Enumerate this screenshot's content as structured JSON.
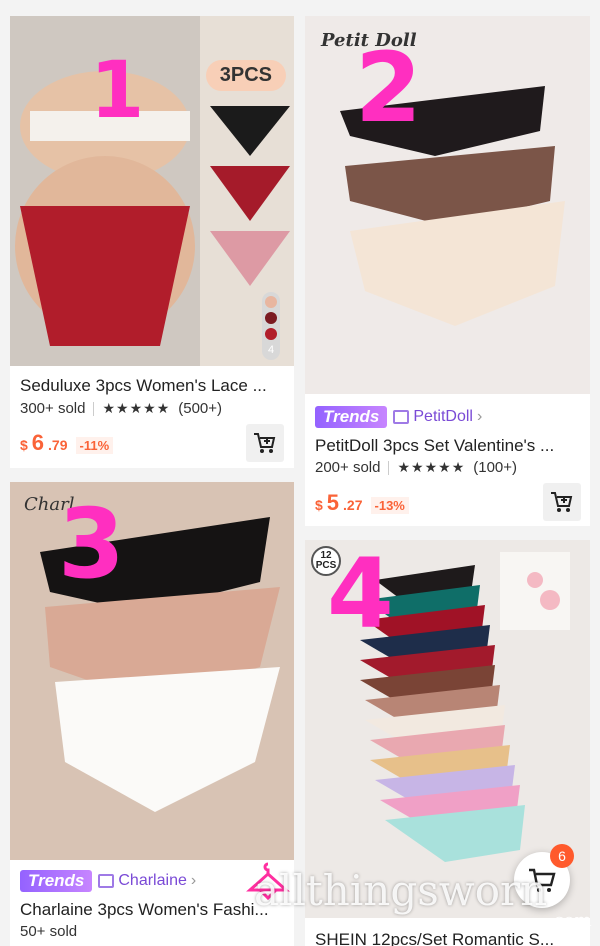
{
  "products": [
    {
      "title": "Seduluxe 3pcs Women's Lace ...",
      "sold": "300+ sold",
      "stars": "★★★★★",
      "reviews": "(500+)",
      "price_currency": "$",
      "price_int": "6",
      "price_dec": ".79",
      "discount": "-11%",
      "pack_badge": "3PCS",
      "image_count": "4",
      "annotation": "1"
    },
    {
      "brand_watermark": "Petit Doll",
      "trend_badge": "Trends",
      "store": "PetitDoll",
      "title": "PetitDoll 3pcs Set Valentine's ...",
      "sold": "200+ sold",
      "stars": "★★★★★",
      "reviews": "(100+)",
      "price_currency": "$",
      "price_int": "5",
      "price_dec": ".27",
      "discount": "-13%",
      "annotation": "2"
    },
    {
      "brand_watermark": "Charl",
      "trend_badge": "Trends",
      "store": "Charlaine",
      "title": "Charlaine 3pcs Women's Fashi...",
      "sold": "50+ sold",
      "annotation": "3"
    },
    {
      "pack_badge": "12 PCS",
      "title": "SHEIN 12pcs/Set Romantic S...",
      "annotation": "4"
    }
  ],
  "floating_cart": {
    "count": "6"
  },
  "watermark": {
    "text": "allthingsworn",
    "sub": ".com"
  },
  "colors": {
    "accent": "#fa6338",
    "trend": "#9462ff",
    "annotation": "#ff2fc0"
  }
}
